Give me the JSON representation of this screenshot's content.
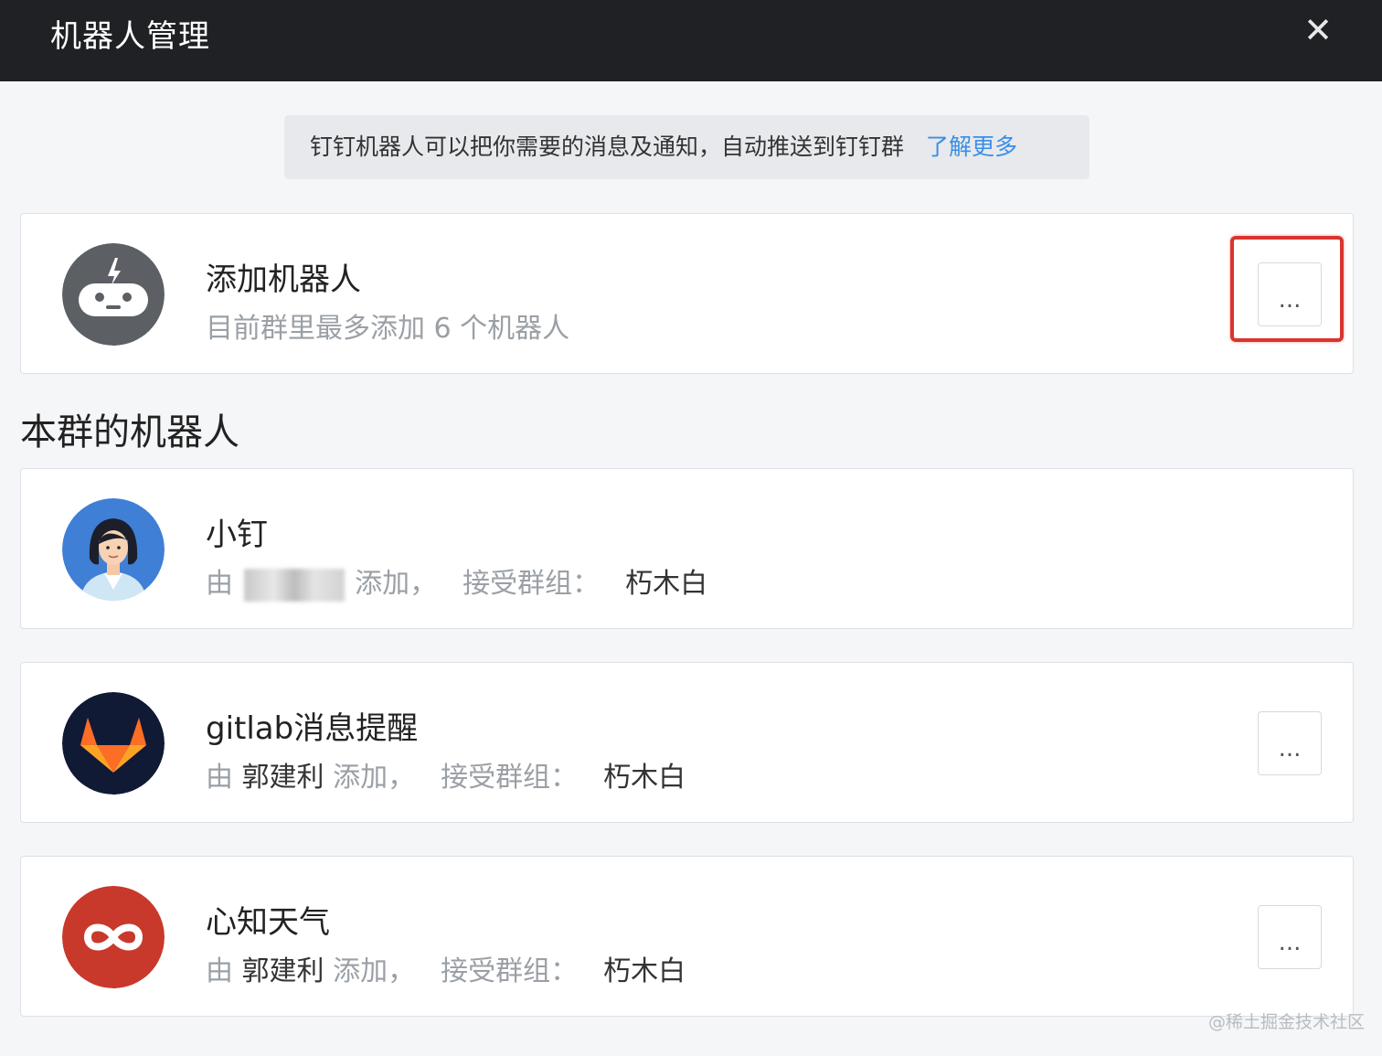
{
  "window": {
    "title": "机器人管理",
    "close_label": "✕"
  },
  "banner": {
    "text": "钉钉机器人可以把你需要的消息及通知，自动推送到钉钉群",
    "link": "了解更多"
  },
  "add_card": {
    "name": "添加机器人",
    "description": "目前群里最多添加 6 个机器人",
    "more_label": "..."
  },
  "section": {
    "title": "本群的机器人"
  },
  "robots": [
    {
      "name": "小钉",
      "by": "由",
      "adder": "",
      "added": "添加，",
      "group_label": "接受群组：",
      "group": "朽木白",
      "icon": "woman-avatar-icon"
    },
    {
      "name": "gitlab消息提醒",
      "by": "由",
      "adder": "郭建利",
      "added": "添加，",
      "group_label": "接受群组：",
      "group": "朽木白",
      "more_label": "...",
      "icon": "gitlab-fox-icon"
    },
    {
      "name": "心知天气",
      "by": "由",
      "adder": "郭建利",
      "added": "添加，",
      "group_label": "接受群组：",
      "group": "朽木白",
      "more_label": "...",
      "icon": "infinity-logo-icon"
    }
  ],
  "watermark": "@稀土掘金技术社区",
  "colors": {
    "titlebar": "#1f2124",
    "link": "#3a8ee6",
    "highlight": "#d9352f",
    "robot_avatar_gray": "#5c6065"
  }
}
